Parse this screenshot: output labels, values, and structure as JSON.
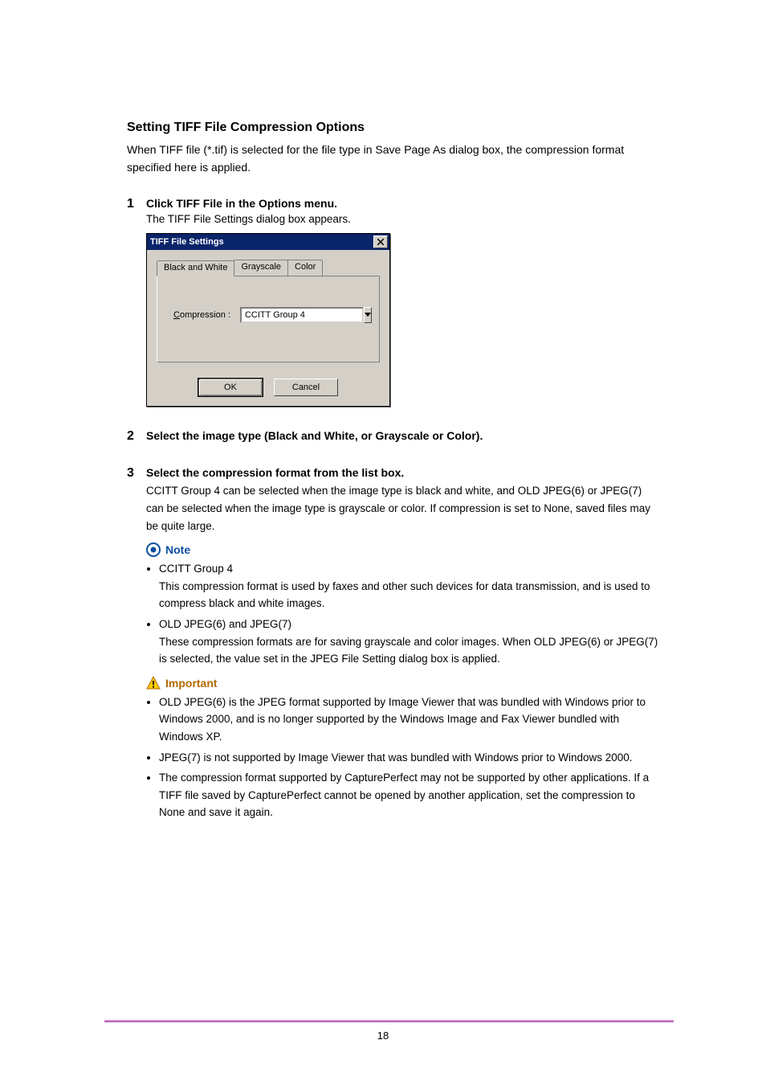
{
  "title": "Setting TIFF File Compression Options",
  "intro": "When TIFF file (*.tif) is selected for the file type in Save Page As dialog box, the compression format specified here is applied.",
  "steps": [
    {
      "num": "1",
      "head": "Click TIFF File in the Options menu.",
      "sub": "The TIFF File Settings dialog box appears."
    },
    {
      "num": "2",
      "head": "Select the image type (Black and White, or Grayscale or Color)."
    },
    {
      "num": "3",
      "head": "Select the compression format from the list box.",
      "desc": "CCITT Group 4 can be selected when the image type is black and white, and OLD JPEG(6) or JPEG(7) can be selected when the image type is grayscale or color. If compression is set to None, saved files may be quite large."
    }
  ],
  "dialog": {
    "title": "TIFF File Settings",
    "tabs": [
      "Black and White",
      "Grayscale",
      "Color"
    ],
    "compression_prefix": "C",
    "compression_rest": "ompression :",
    "compression_value": "CCITT Group 4",
    "ok": "OK",
    "cancel": "Cancel"
  },
  "note": {
    "label": "Note",
    "items": [
      {
        "head": "CCITT Group 4",
        "body": "This compression format is used by faxes and other such devices for data transmission, and is used to compress black and white images."
      },
      {
        "head": "OLD JPEG(6) and JPEG(7)",
        "body": "These compression formats are for saving grayscale and color images. When OLD JPEG(6) or JPEG(7) is selected, the value set in the JPEG File Setting dialog box is applied."
      }
    ]
  },
  "important": {
    "label": "Important",
    "items": [
      "OLD JPEG(6) is the JPEG format supported by Image Viewer that was bundled with Windows prior to Windows 2000, and is no longer supported by the Windows Image and Fax Viewer bundled with Windows XP.",
      "JPEG(7) is not supported by Image Viewer that was bundled with Windows prior to Windows 2000.",
      "The compression format supported by CapturePerfect may not be supported by other applications. If a TIFF file saved by CapturePerfect cannot be opened by another application, set the compression to None and save it again."
    ]
  },
  "page_number": "18"
}
